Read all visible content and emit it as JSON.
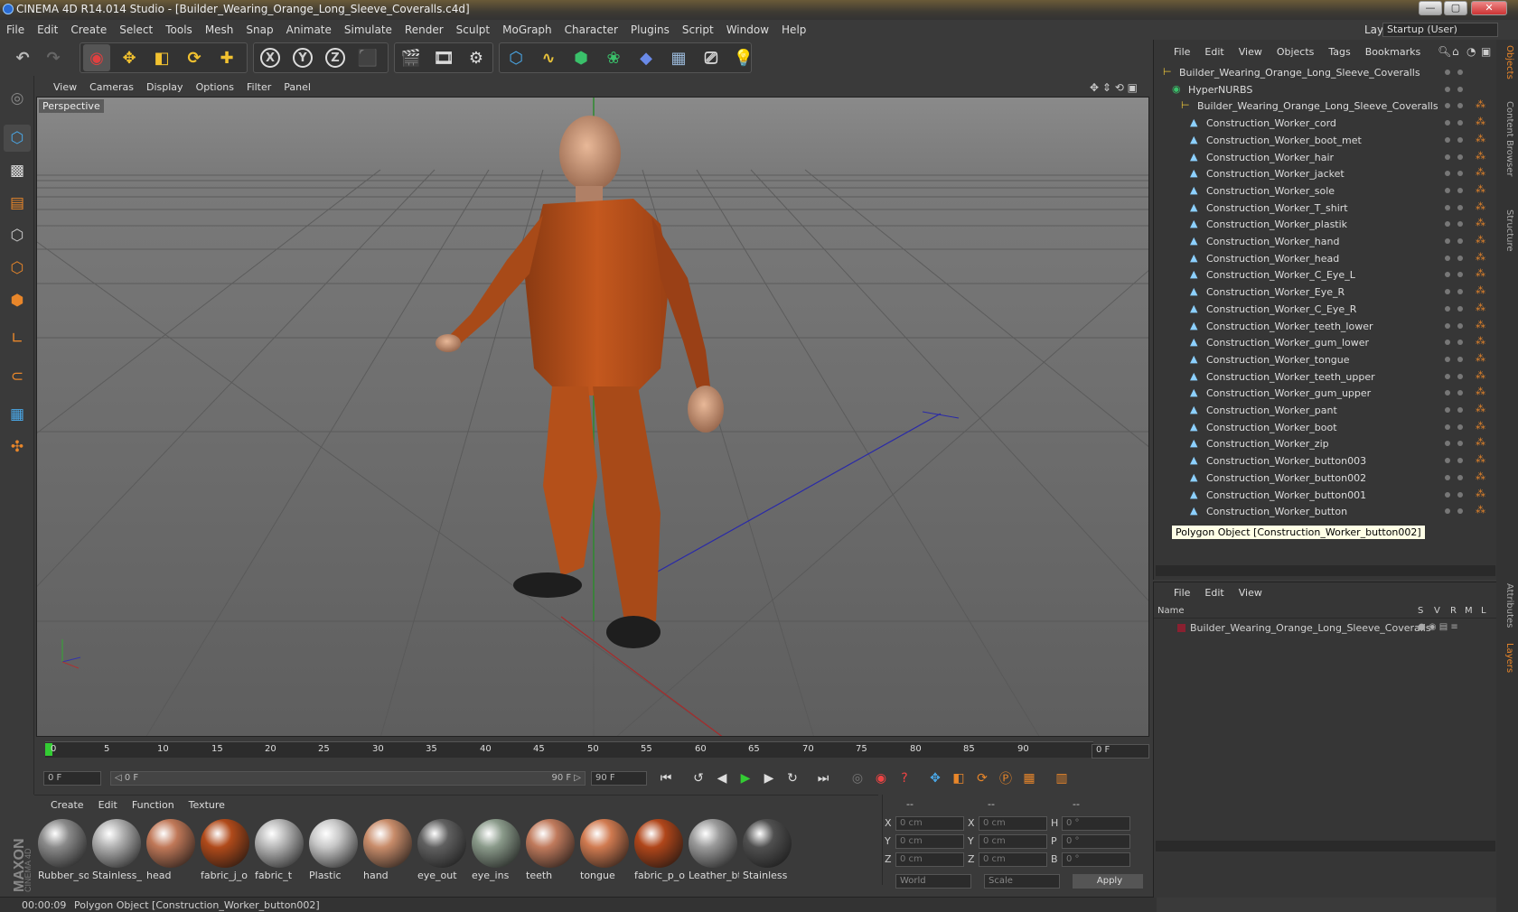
{
  "window": {
    "title": "CINEMA 4D R14.014 Studio - [Builder_Wearing_Orange_Long_Sleeve_Coveralls.c4d]",
    "min_label": "—",
    "max_label": "▢",
    "close_label": "✕"
  },
  "menubar": {
    "items": [
      "File",
      "Edit",
      "Create",
      "Select",
      "Tools",
      "Mesh",
      "Snap",
      "Animate",
      "Simulate",
      "Render",
      "Sculpt",
      "MoGraph",
      "Character",
      "Plugins",
      "Script",
      "Window",
      "Help"
    ],
    "layout_label": "Layout:",
    "layout_value": "Startup (User)"
  },
  "viewport": {
    "menu": [
      "View",
      "Cameras",
      "Display",
      "Options",
      "Filter",
      "Panel"
    ],
    "label": "Perspective"
  },
  "timeline": {
    "ticks": [
      "0",
      "5",
      "10",
      "15",
      "20",
      "25",
      "30",
      "35",
      "40",
      "45",
      "50",
      "55",
      "60",
      "65",
      "70",
      "75",
      "80",
      "85",
      "90"
    ],
    "end_field": "0 F"
  },
  "transport": {
    "current_frame": "0 F",
    "range_start": "◁ 0 F",
    "range_end": "90 F ▷",
    "max_frame": "90 F"
  },
  "materials": {
    "menu": [
      "Create",
      "Edit",
      "Function",
      "Texture"
    ],
    "items": [
      {
        "label": "Rubber_so",
        "color": "#8a8a8a"
      },
      {
        "label": "Stainless_",
        "color": "#b0b0b0"
      },
      {
        "label": "head",
        "color": "#c07858"
      },
      {
        "label": "fabric_j_o",
        "color": "#b04a1a"
      },
      {
        "label": "fabric_t",
        "color": "#b8b8b8"
      },
      {
        "label": "Plastic",
        "color": "#c8c8c8"
      },
      {
        "label": "hand",
        "color": "#c88c6a"
      },
      {
        "label": "eye_out",
        "color": "#606060"
      },
      {
        "label": "eye_ins",
        "color": "#8a9a8a"
      },
      {
        "label": "teeth",
        "color": "#c07a5c"
      },
      {
        "label": "tongue",
        "color": "#d07a50"
      },
      {
        "label": "fabric_p_o",
        "color": "#b0461a"
      },
      {
        "label": "Leather_bt",
        "color": "#9a9a9a"
      },
      {
        "label": "Stainless",
        "color": "#505050"
      }
    ]
  },
  "coords": {
    "headers": [
      "--",
      "--",
      "--"
    ],
    "rows": [
      {
        "a": "X",
        "av": "0 cm",
        "b": "X",
        "bv": "0 cm",
        "c": "H",
        "cv": "0 °"
      },
      {
        "a": "Y",
        "av": "0 cm",
        "b": "Y",
        "bv": "0 cm",
        "c": "P",
        "cv": "0 °"
      },
      {
        "a": "Z",
        "av": "0 cm",
        "b": "Z",
        "bv": "0 cm",
        "c": "B",
        "cv": "0 °"
      }
    ],
    "world": "World",
    "scale": "Scale",
    "apply": "Apply"
  },
  "status": {
    "time": "00:00:09",
    "message": "Polygon Object [Construction_Worker_button002]"
  },
  "objects": {
    "menu": [
      "File",
      "Edit",
      "View",
      "Objects",
      "Tags",
      "Bookmarks"
    ],
    "root": "Builder_Wearing_Orange_Long_Sleeve_Coveralls",
    "hypernurbs": "HyperNURBS",
    "group": "Builder_Wearing_Orange_Long_Sleeve_Coveralls",
    "children": [
      "Construction_Worker_cord",
      "Construction_Worker_boot_met",
      "Construction_Worker_hair",
      "Construction_Worker_jacket",
      "Construction_Worker_sole",
      "Construction_Worker_T_shirt",
      "Construction_Worker_plastik",
      "Construction_Worker_hand",
      "Construction_Worker_head",
      "Construction_Worker_C_Eye_L",
      "Construction_Worker_Eye_R",
      "Construction_Worker_C_Eye_R",
      "Construction_Worker_teeth_lower",
      "Construction_Worker_gum_lower",
      "Construction_Worker_tongue",
      "Construction_Worker_teeth_upper",
      "Construction_Worker_gum_upper",
      "Construction_Worker_pant",
      "Construction_Worker_boot",
      "Construction_Worker_zip",
      "Construction_Worker_button003",
      "Construction_Worker_button002",
      "Construction_Worker_button001",
      "Construction_Worker_button"
    ],
    "tooltip": "Polygon Object [Construction_Worker_button002]"
  },
  "layers": {
    "menu": [
      "File",
      "Edit",
      "View"
    ],
    "col_name": "Name",
    "cols": [
      "S",
      "V",
      "R",
      "M",
      "L"
    ],
    "row": "Builder_Wearing_Orange_Long_Sleeve_Coveralls"
  },
  "sidetabs": [
    "Objects",
    "Content Browser",
    "Structure",
    "Attributes",
    "Layers"
  ],
  "colors": {
    "accent": "#e8862a",
    "coverall": "#c0561c"
  }
}
